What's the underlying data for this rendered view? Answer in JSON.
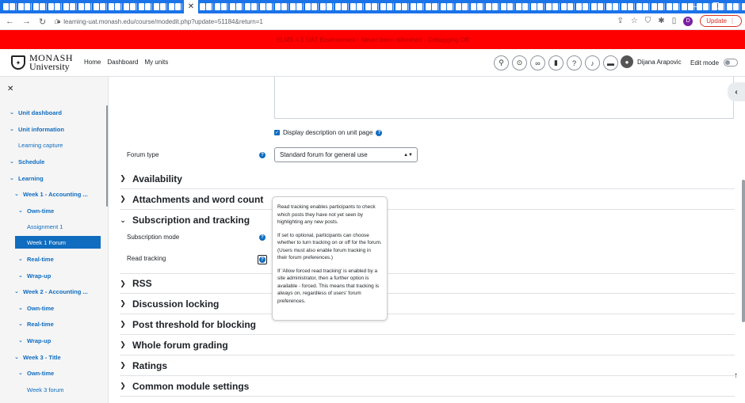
{
  "browser": {
    "url": "learning-uat.monash.edu/course/modedit.php?update=51184&return=1",
    "update_label": "Update",
    "profile_initial": "D"
  },
  "banner": {
    "text": "ELMS 4.1 UAT Environment - Never been refreshed - Debugging Off"
  },
  "navbar": {
    "logo_line1": "MONASH",
    "logo_line2": "University",
    "links": [
      "Home",
      "Dashboard",
      "My units"
    ],
    "user_name": "Dijana Arapovic",
    "edit_mode_label": "Edit mode"
  },
  "drawer": {
    "items": [
      {
        "label": "Unit dashboard"
      },
      {
        "label": "Unit information"
      },
      {
        "label": "Learning capture"
      },
      {
        "label": "Schedule"
      },
      {
        "label": "Learning"
      },
      {
        "label": "Week 1 - Accounting ..."
      },
      {
        "label": "Own-time"
      },
      {
        "label": "Assignment 1"
      },
      {
        "label": "Week 1 Forum"
      },
      {
        "label": "Real-time"
      },
      {
        "label": "Wrap-up"
      },
      {
        "label": "Week 2 - Accounting ..."
      },
      {
        "label": "Own-time"
      },
      {
        "label": "Real-time"
      },
      {
        "label": "Wrap-up"
      },
      {
        "label": "Week 3 - Title"
      },
      {
        "label": "Own-time"
      },
      {
        "label": "Week 3 forum"
      }
    ]
  },
  "form": {
    "display_description_label": "Display description on unit page",
    "forum_type_label": "Forum type",
    "forum_type_value": "Standard forum for general use",
    "subscription_mode_label": "Subscription mode",
    "read_tracking_label": "Read tracking",
    "sections": [
      "Availability",
      "Attachments and word count",
      "Subscription and tracking",
      "RSS",
      "Discussion locking",
      "Post threshold for blocking",
      "Whole forum grading",
      "Ratings",
      "Common module settings"
    ]
  },
  "popover": {
    "p1": "Read tracking enables participants to check which posts they have not yet seen by highlighting any new posts.",
    "p2": "If set to optional, participants can choose whether to turn tracking on or off for the forum. (Users must also enable forum tracking in their forum preferences.)",
    "p3": "If 'Allow forced read tracking' is enabled by a site administrator, then a further option is available - forced. This means that tracking is always on, regardless of users' forum preferences."
  }
}
